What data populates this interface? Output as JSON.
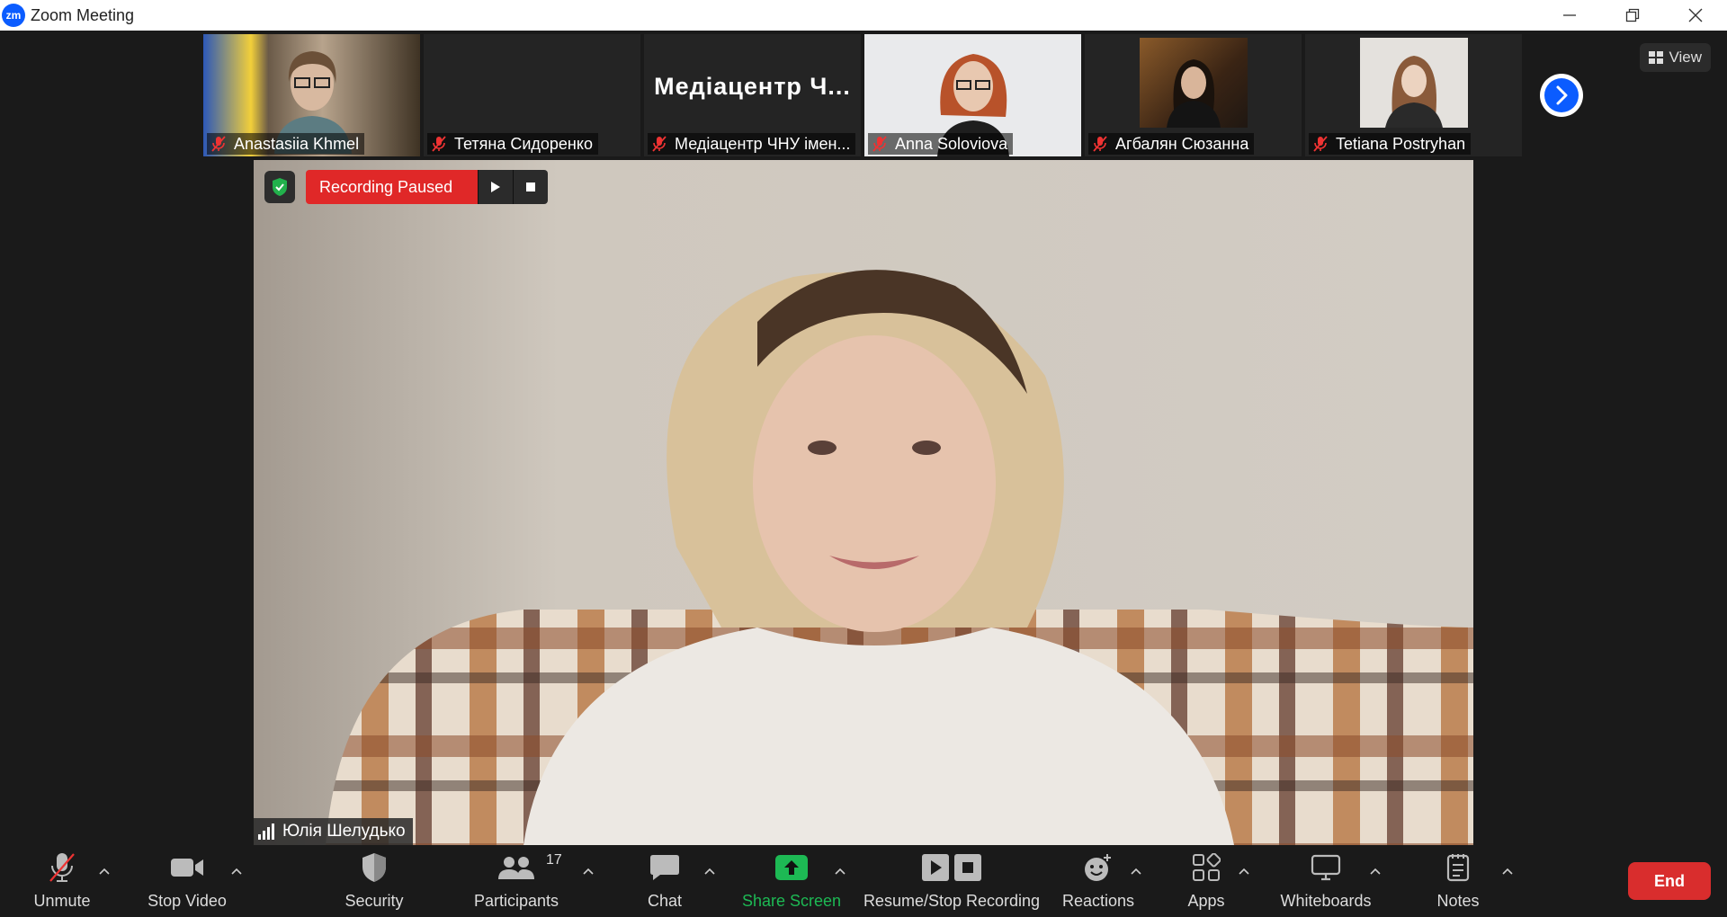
{
  "window": {
    "title": "Zoom Meeting",
    "logo_text": "zm"
  },
  "gallery": {
    "participants": [
      {
        "name": "Anastasiia Khmel",
        "has_video": true
      },
      {
        "name": "Тетяна Сидоренко",
        "has_video": false
      },
      {
        "name": "Медіацентр ЧНУ імен...",
        "display_text": "Медіацентр Ч...",
        "has_video": false
      },
      {
        "name": "Anna Soloviova",
        "has_video": true
      },
      {
        "name": "Агбалян Сюзанна",
        "has_video": true
      },
      {
        "name": "Tetiana Postryhan",
        "has_video": true
      }
    ],
    "view_label": "View"
  },
  "recording": {
    "status": "Recording Paused"
  },
  "active_speaker": {
    "name": "Юлія Шелудько"
  },
  "toolbar": {
    "unmute": "Unmute",
    "stop_video": "Stop Video",
    "security": "Security",
    "participants": "Participants",
    "participants_count": "17",
    "chat": "Chat",
    "share_screen": "Share Screen",
    "recording": "Resume/Stop Recording",
    "reactions": "Reactions",
    "apps": "Apps",
    "whiteboards": "Whiteboards",
    "notes": "Notes",
    "end": "End"
  },
  "colors": {
    "accent": "#0b5cff",
    "recording": "#e02828",
    "share": "#1db954",
    "end": "#d92d2d",
    "background": "#1a1a1a"
  }
}
